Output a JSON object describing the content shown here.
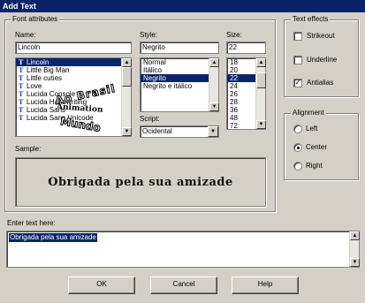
{
  "window": {
    "title": "Add Text"
  },
  "font_attributes": {
    "legend": "Font attributes",
    "name_label": "Name:",
    "name_value": "Lincoln",
    "fonts": [
      "Lincoln",
      "Little Big Man",
      "Little cuties",
      "Love",
      "Lucida Console",
      "Lucida Handwriting",
      "Lucida Sans",
      "Lucida Sans Unicode"
    ],
    "selected_font": "Lincoln",
    "style_label": "Style:",
    "style_value": "Negrito",
    "styles": [
      "Normal",
      "Itálico",
      "Negrito",
      "Negrito e itálico"
    ],
    "selected_style": "Negrito",
    "size_label": "Size:",
    "size_value": "22",
    "sizes": [
      "18",
      "20",
      "22",
      "24",
      "26",
      "28",
      "36",
      "48",
      "72"
    ],
    "selected_size": "22",
    "script_label": "Script:",
    "script_value": "Ocidental",
    "sample_label": "Sample:",
    "sample_text": "Obrigada pela sua amizade"
  },
  "overlay_stamp": {
    "line1": "Ao Brasil",
    "line2": "Animation",
    "line3": "Mundo"
  },
  "text_effects": {
    "legend": "Text effects",
    "options": [
      {
        "label": "Strikeout",
        "checked": false
      },
      {
        "label": "Underline",
        "checked": false
      },
      {
        "label": "Antialias",
        "checked": true
      }
    ]
  },
  "alignment": {
    "legend": "Alignment",
    "options": [
      {
        "label": "Left",
        "selected": false
      },
      {
        "label": "Center",
        "selected": true
      },
      {
        "label": "Right",
        "selected": false
      }
    ]
  },
  "enter_text": {
    "label": "Enter text here:",
    "value": "Obrigada pela sua amizade"
  },
  "buttons": {
    "ok": "OK",
    "cancel": "Cancel",
    "help": "Help"
  },
  "icons": {
    "font_type": "truetype-icon",
    "check": "checkmark-icon"
  }
}
